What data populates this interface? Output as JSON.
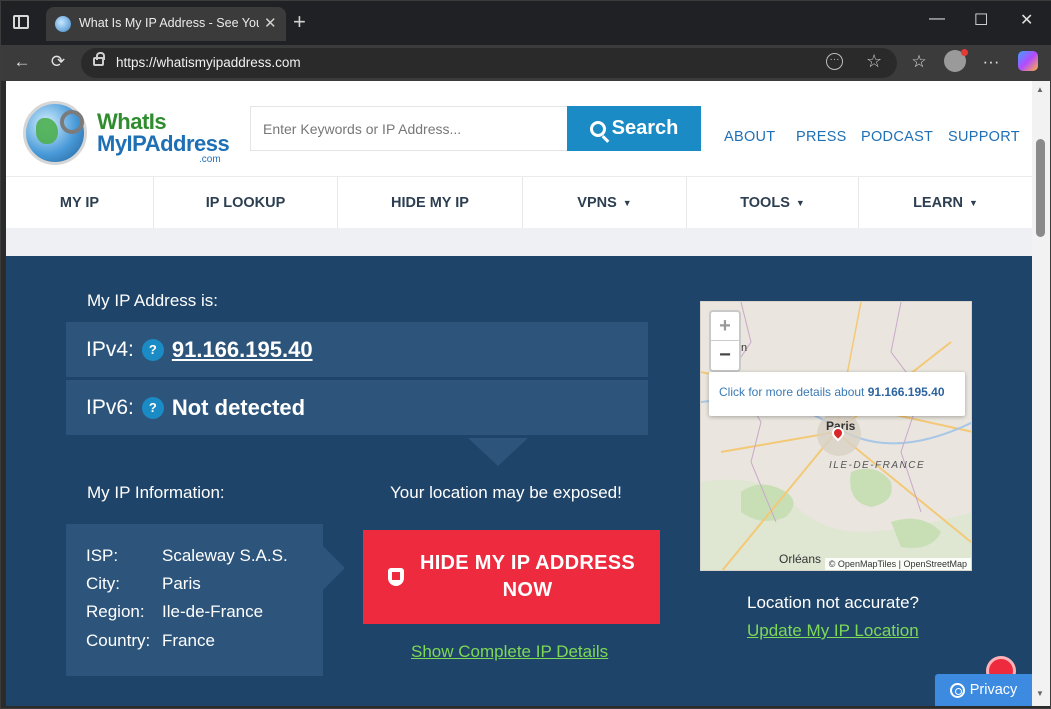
{
  "browser": {
    "tab_title": "What Is My IP Address - See Your",
    "tab_close": "✕",
    "new_tab": "+",
    "url": "https://whatismyipaddress.com",
    "controls": {
      "minimize": "—",
      "maximize": "☐",
      "close": "✕"
    },
    "nav": {
      "back": "←",
      "reload": "⟳",
      "favorite": "☆",
      "favorites": "☆",
      "more": "···"
    }
  },
  "site": {
    "logo": {
      "line1": "WhatIs",
      "line2": "MyIPAddress",
      "line3": ".com"
    },
    "search": {
      "placeholder": "Enter Keywords or IP Address...",
      "button": "Search"
    },
    "top_links": [
      "ABOUT",
      "PRESS",
      "PODCAST",
      "SUPPORT"
    ],
    "nav": [
      {
        "label": "MY IP",
        "caret": ""
      },
      {
        "label": "IP LOOKUP",
        "caret": ""
      },
      {
        "label": "HIDE MY IP",
        "caret": ""
      },
      {
        "label": "VPNS",
        "caret": "▼"
      },
      {
        "label": "TOOLS",
        "caret": "▼"
      },
      {
        "label": "LEARN",
        "caret": "▼"
      }
    ]
  },
  "main": {
    "my_ip_label": "My IP Address is:",
    "ipv4_label": "IPv4:",
    "ipv4_value": "91.166.195.40",
    "ipv6_label": "IPv6:",
    "ipv6_value": "Not detected",
    "help": "?",
    "info_label": "My IP Information:",
    "exposed": "Your location may be exposed!",
    "info": [
      {
        "key": "ISP:",
        "value": "Scaleway S.A.S."
      },
      {
        "key": "City:",
        "value": "Paris"
      },
      {
        "key": "Region:",
        "value": "Ile-de-France"
      },
      {
        "key": "Country:",
        "value": "France"
      }
    ],
    "hide_button": [
      "HIDE MY IP ADDRESS",
      "NOW"
    ],
    "details_link": "Show Complete IP Details",
    "map": {
      "zoom_in": "+",
      "zoom_out": "−",
      "popup_text": "Click for more details about",
      "popup_ip": "91.166.195.40",
      "city": "Paris",
      "region": "ILE-DE-FRANCE",
      "town": "Orléans",
      "partial": "n",
      "attribution": "© OpenMapTiles | OpenStreetMap"
    },
    "location_question": "Location not accurate?",
    "update_link": "Update My IP Location",
    "privacy": "Privacy"
  }
}
